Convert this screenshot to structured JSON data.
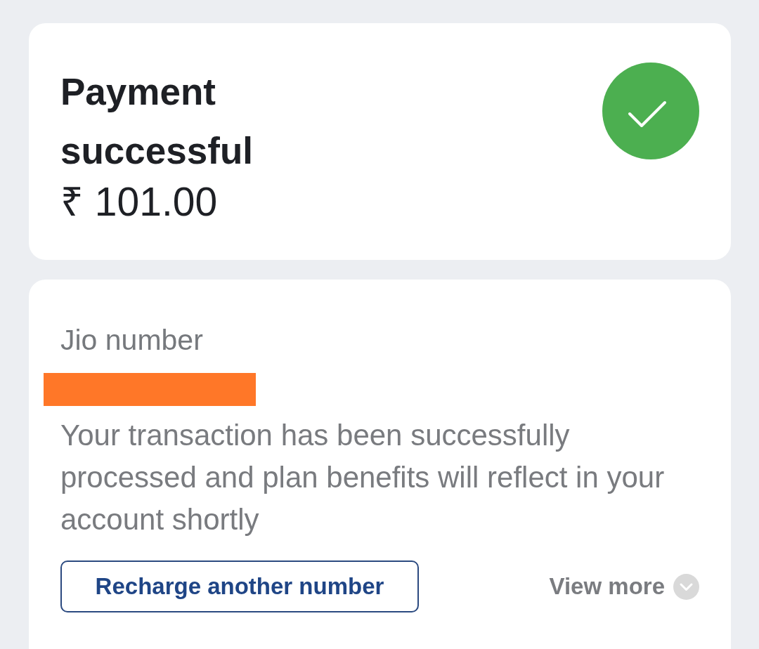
{
  "header_card": {
    "title": "Payment successful",
    "amount": "₹ 101.00",
    "success": true
  },
  "details_card": {
    "label": "Jio number",
    "message": "Your transaction has been successfully processed and plan benefits will reflect in your account shortly",
    "primary_button": "Recharge another number",
    "view_more": {
      "label": "View more",
      "expanded": false
    }
  }
}
